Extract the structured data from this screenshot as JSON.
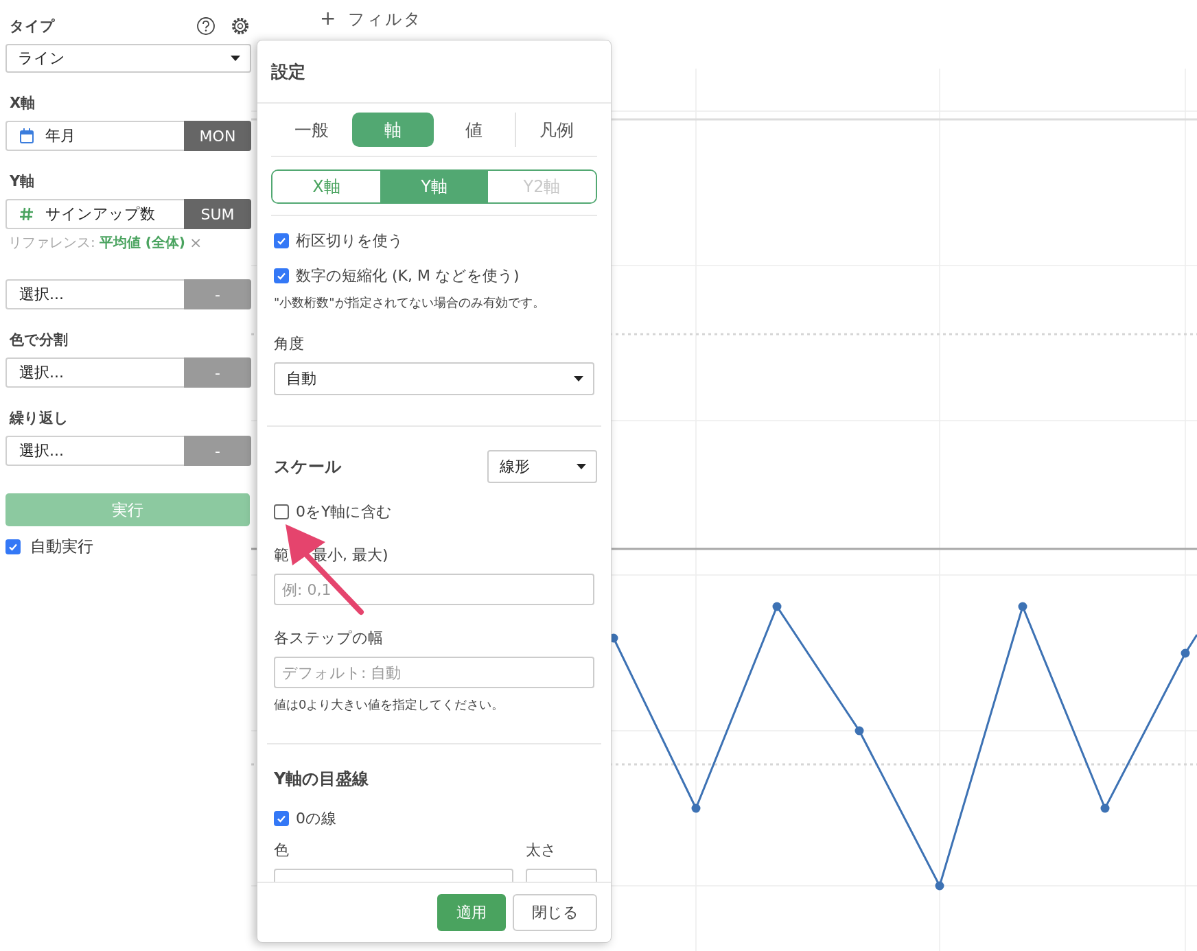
{
  "sidebar": {
    "type_label": "タイプ",
    "type_select": {
      "value": "ライン"
    },
    "fields": [
      {
        "kind": "date",
        "label": "X軸",
        "value": "年月",
        "aggregate": "MON"
      },
      {
        "kind": "number",
        "label": "Y軸",
        "value": "サインアップ数",
        "aggregate": "SUM",
        "reference": {
          "prefix": "リファレンス:",
          "value": "平均値 (全体)",
          "remove": "×"
        }
      },
      {
        "kind": "empty",
        "value": "選択...",
        "aggregate": "-"
      },
      {
        "kind": "empty",
        "label": "色で分割",
        "value": "選択...",
        "aggregate": "-"
      },
      {
        "kind": "empty",
        "label": "繰り返し",
        "value": "選択...",
        "aggregate": "-"
      }
    ],
    "run_button": {
      "label": "実行",
      "disabled": true
    },
    "auto_run": {
      "label": "自動実行",
      "checked": true
    }
  },
  "filter_button": {
    "icon": "+",
    "label": "フィルタ"
  },
  "dialog": {
    "title": "設定",
    "tabs": [
      {
        "label": "一般",
        "selected": false
      },
      {
        "label": "軸",
        "selected": true
      },
      {
        "label": "値",
        "selected": false
      },
      {
        "label": "凡例",
        "selected": false
      }
    ],
    "axis_tabs": [
      {
        "label": "X軸",
        "selected": false,
        "disabled": false
      },
      {
        "label": "Y軸",
        "selected": true,
        "disabled": false
      },
      {
        "label": "Y2軸",
        "selected": false,
        "disabled": true
      }
    ],
    "sections": [
      {
        "items": [
          {
            "kind": "checkbox",
            "label": "桁区切りを使う",
            "checked": true
          },
          {
            "kind": "checkbox",
            "label": "数字の短縮化 (K, M などを使う)",
            "checked": true
          },
          {
            "kind": "note",
            "text": "\"小数桁数\"が指定されてない場合のみ有効です。"
          },
          {
            "kind": "select",
            "label": "角度",
            "value": "自動"
          }
        ]
      },
      {
        "title": "スケール",
        "title_select": "線形",
        "items": [
          {
            "kind": "checkbox",
            "label": "0をY軸に含む",
            "checked": false
          },
          {
            "kind": "input",
            "label_parts": [
              "範",
              "最小, 最大)"
            ],
            "placeholder": "例: 0,1"
          },
          {
            "kind": "input",
            "label": "各ステップの幅",
            "placeholder": "デフォルト: 自動"
          },
          {
            "kind": "note",
            "text": "値は0より大きい値を指定してください。"
          }
        ]
      },
      {
        "title": "Y軸の目盛線",
        "items": [
          {
            "kind": "checkbox",
            "label": "0の線",
            "checked": true
          },
          {
            "kind": "pair",
            "labels": [
              "色",
              "太さ"
            ]
          }
        ]
      }
    ],
    "buttons": [
      {
        "kind": "primary",
        "label": "適用"
      },
      {
        "kind": "secondary",
        "label": "閉じる"
      }
    ]
  }
}
